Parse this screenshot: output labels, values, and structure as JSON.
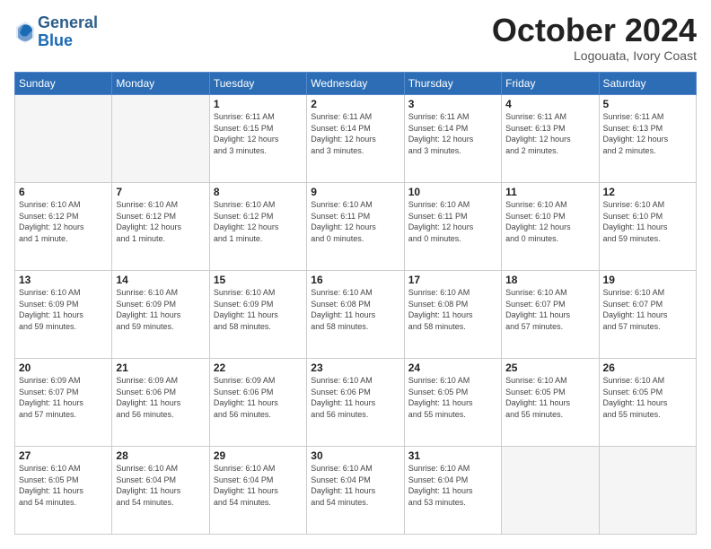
{
  "header": {
    "logo_line1": "General",
    "logo_line2": "Blue",
    "month": "October 2024",
    "location": "Logouata, Ivory Coast"
  },
  "weekdays": [
    "Sunday",
    "Monday",
    "Tuesday",
    "Wednesday",
    "Thursday",
    "Friday",
    "Saturday"
  ],
  "weeks": [
    [
      {
        "day": "",
        "info": ""
      },
      {
        "day": "",
        "info": ""
      },
      {
        "day": "1",
        "info": "Sunrise: 6:11 AM\nSunset: 6:15 PM\nDaylight: 12 hours\nand 3 minutes."
      },
      {
        "day": "2",
        "info": "Sunrise: 6:11 AM\nSunset: 6:14 PM\nDaylight: 12 hours\nand 3 minutes."
      },
      {
        "day": "3",
        "info": "Sunrise: 6:11 AM\nSunset: 6:14 PM\nDaylight: 12 hours\nand 3 minutes."
      },
      {
        "day": "4",
        "info": "Sunrise: 6:11 AM\nSunset: 6:13 PM\nDaylight: 12 hours\nand 2 minutes."
      },
      {
        "day": "5",
        "info": "Sunrise: 6:11 AM\nSunset: 6:13 PM\nDaylight: 12 hours\nand 2 minutes."
      }
    ],
    [
      {
        "day": "6",
        "info": "Sunrise: 6:10 AM\nSunset: 6:12 PM\nDaylight: 12 hours\nand 1 minute."
      },
      {
        "day": "7",
        "info": "Sunrise: 6:10 AM\nSunset: 6:12 PM\nDaylight: 12 hours\nand 1 minute."
      },
      {
        "day": "8",
        "info": "Sunrise: 6:10 AM\nSunset: 6:12 PM\nDaylight: 12 hours\nand 1 minute."
      },
      {
        "day": "9",
        "info": "Sunrise: 6:10 AM\nSunset: 6:11 PM\nDaylight: 12 hours\nand 0 minutes."
      },
      {
        "day": "10",
        "info": "Sunrise: 6:10 AM\nSunset: 6:11 PM\nDaylight: 12 hours\nand 0 minutes."
      },
      {
        "day": "11",
        "info": "Sunrise: 6:10 AM\nSunset: 6:10 PM\nDaylight: 12 hours\nand 0 minutes."
      },
      {
        "day": "12",
        "info": "Sunrise: 6:10 AM\nSunset: 6:10 PM\nDaylight: 11 hours\nand 59 minutes."
      }
    ],
    [
      {
        "day": "13",
        "info": "Sunrise: 6:10 AM\nSunset: 6:09 PM\nDaylight: 11 hours\nand 59 minutes."
      },
      {
        "day": "14",
        "info": "Sunrise: 6:10 AM\nSunset: 6:09 PM\nDaylight: 11 hours\nand 59 minutes."
      },
      {
        "day": "15",
        "info": "Sunrise: 6:10 AM\nSunset: 6:09 PM\nDaylight: 11 hours\nand 58 minutes."
      },
      {
        "day": "16",
        "info": "Sunrise: 6:10 AM\nSunset: 6:08 PM\nDaylight: 11 hours\nand 58 minutes."
      },
      {
        "day": "17",
        "info": "Sunrise: 6:10 AM\nSunset: 6:08 PM\nDaylight: 11 hours\nand 58 minutes."
      },
      {
        "day": "18",
        "info": "Sunrise: 6:10 AM\nSunset: 6:07 PM\nDaylight: 11 hours\nand 57 minutes."
      },
      {
        "day": "19",
        "info": "Sunrise: 6:10 AM\nSunset: 6:07 PM\nDaylight: 11 hours\nand 57 minutes."
      }
    ],
    [
      {
        "day": "20",
        "info": "Sunrise: 6:09 AM\nSunset: 6:07 PM\nDaylight: 11 hours\nand 57 minutes."
      },
      {
        "day": "21",
        "info": "Sunrise: 6:09 AM\nSunset: 6:06 PM\nDaylight: 11 hours\nand 56 minutes."
      },
      {
        "day": "22",
        "info": "Sunrise: 6:09 AM\nSunset: 6:06 PM\nDaylight: 11 hours\nand 56 minutes."
      },
      {
        "day": "23",
        "info": "Sunrise: 6:10 AM\nSunset: 6:06 PM\nDaylight: 11 hours\nand 56 minutes."
      },
      {
        "day": "24",
        "info": "Sunrise: 6:10 AM\nSunset: 6:05 PM\nDaylight: 11 hours\nand 55 minutes."
      },
      {
        "day": "25",
        "info": "Sunrise: 6:10 AM\nSunset: 6:05 PM\nDaylight: 11 hours\nand 55 minutes."
      },
      {
        "day": "26",
        "info": "Sunrise: 6:10 AM\nSunset: 6:05 PM\nDaylight: 11 hours\nand 55 minutes."
      }
    ],
    [
      {
        "day": "27",
        "info": "Sunrise: 6:10 AM\nSunset: 6:05 PM\nDaylight: 11 hours\nand 54 minutes."
      },
      {
        "day": "28",
        "info": "Sunrise: 6:10 AM\nSunset: 6:04 PM\nDaylight: 11 hours\nand 54 minutes."
      },
      {
        "day": "29",
        "info": "Sunrise: 6:10 AM\nSunset: 6:04 PM\nDaylight: 11 hours\nand 54 minutes."
      },
      {
        "day": "30",
        "info": "Sunrise: 6:10 AM\nSunset: 6:04 PM\nDaylight: 11 hours\nand 54 minutes."
      },
      {
        "day": "31",
        "info": "Sunrise: 6:10 AM\nSunset: 6:04 PM\nDaylight: 11 hours\nand 53 minutes."
      },
      {
        "day": "",
        "info": ""
      },
      {
        "day": "",
        "info": ""
      }
    ]
  ]
}
